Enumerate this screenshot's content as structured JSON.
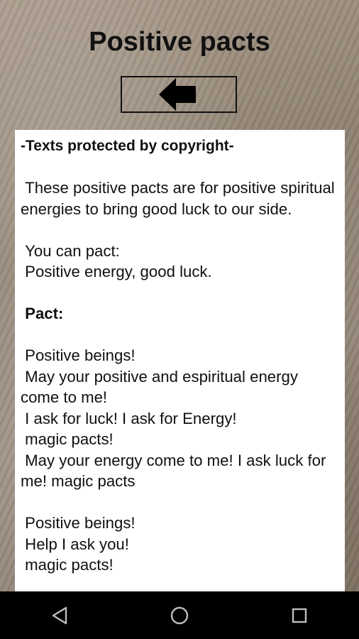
{
  "header": {
    "title": "Positive pacts"
  },
  "toolbar": {
    "back_icon": "left-arrow-icon"
  },
  "content": {
    "copyright_notice": "-Texts protected by copyright-",
    "intro": " These positive pacts are for positive spiritual energies to bring good luck to our side.",
    "can_pact_label": " You can pact:",
    "can_pact_value": " Positive energy, good luck.",
    "pact_heading": " Pact:",
    "lines": [
      " Positive beings!",
      " May your positive and espiritual energy come to me!",
      " I ask for luck! I ask for Energy!",
      " magic pacts!",
      " May your energy come to me! I ask luck for me! magic pacts",
      "",
      " Positive beings!",
      " Help I ask you!",
      " magic pacts!"
    ]
  },
  "navbar": {
    "back_icon": "triangle-back-icon",
    "home_icon": "circle-home-icon",
    "recents_icon": "square-recents-icon"
  }
}
